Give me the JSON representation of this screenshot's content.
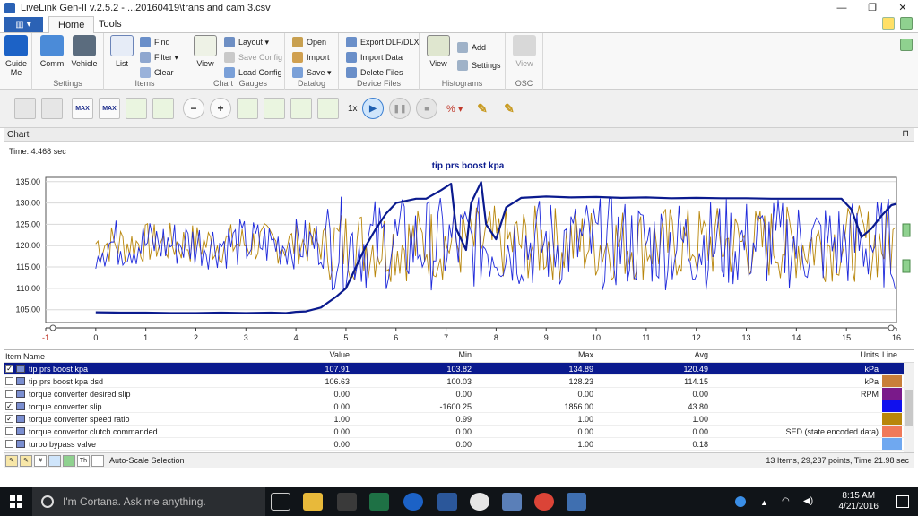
{
  "window": {
    "title": "LiveLink Gen-II  v.2.5.2 - ...20160419\\trans and cam 3.csv",
    "minimize": "—",
    "maximize": "❐",
    "close": "✕"
  },
  "tabs": {
    "home": "Home",
    "tools": "Tools"
  },
  "ribbon": {
    "guide": "Guide\nMe",
    "comm": "Comm",
    "vehicle": "Vehicle",
    "settings_group": "Settings",
    "list": "List",
    "find": "Find",
    "filter": "Filter ▾",
    "clear": "Clear",
    "items_group": "Items",
    "view": "View",
    "layout": "Layout ▾",
    "save_config": "Save Config",
    "load_config": "Load Config",
    "chart_group": "Chart",
    "gauges_group": "Gauges",
    "open": "Open",
    "import": "Import",
    "save": "Save ▾",
    "datalog_group": "Datalog",
    "export_dlf": "Export DLF/DLX",
    "import_data": "Import Data",
    "delete_files": "Delete Files",
    "device_files_group": "Device Files",
    "hist_view": "View",
    "add": "Add",
    "hist_settings": "Settings",
    "histograms_group": "Histograms",
    "osc_view": "View",
    "osc_group": "OSC"
  },
  "toolbar": {
    "max1": "MAX",
    "max2": "MAX",
    "speed": "1x",
    "percent": "% ▾"
  },
  "chart_panel": {
    "header": "Chart",
    "pin": "⊓",
    "time": "Time: 4.468 sec"
  },
  "chart_data": {
    "type": "line",
    "title": "tip prs boost kpa",
    "xlim": [
      -1,
      16
    ],
    "ylim": [
      102,
      136
    ],
    "x_ticks": [
      "-1",
      "0",
      "1",
      "2",
      "3",
      "4",
      "5",
      "6",
      "7",
      "8",
      "9",
      "10",
      "11",
      "12",
      "13",
      "14",
      "15",
      "16"
    ],
    "y_ticks": [
      "105.00",
      "110.00",
      "115.00",
      "120.00",
      "125.00",
      "130.00",
      "135.00"
    ],
    "series": [
      {
        "name": "tip prs boost kpa",
        "color": "#0a1a8e",
        "x": [
          0,
          0.5,
          1,
          1.5,
          2,
          2.5,
          3,
          3.5,
          3.8,
          4,
          4.2,
          4.5,
          4.8,
          5,
          5.2,
          5.4,
          5.6,
          5.8,
          6,
          6.2,
          6.4,
          6.6,
          6.9,
          7.1,
          7.2,
          7.4,
          7.5,
          7.7,
          7.8,
          8,
          8.2,
          8.5,
          9,
          9.5,
          10,
          10.5,
          11,
          11.5,
          12,
          12.5,
          13,
          13.5,
          14,
          14.5,
          14.9,
          15.1,
          15.3,
          15.5,
          15.7,
          15.9,
          16
        ],
        "y": [
          104.4,
          104.3,
          104.3,
          104.2,
          104.2,
          104.3,
          104.2,
          104.3,
          104.2,
          104.5,
          104.6,
          105.5,
          108,
          110,
          115,
          120,
          124,
          127.5,
          130,
          130.5,
          131,
          131,
          133,
          134.5,
          124,
          119,
          130,
          134.9,
          125,
          121.5,
          129,
          131.2,
          131.5,
          131.3,
          131.4,
          131.2,
          131.3,
          131.1,
          131.2,
          131.1,
          131.1,
          131.0,
          131.0,
          131.0,
          131.0,
          128.5,
          122,
          124,
          127,
          129.5,
          129.8
        ]
      },
      {
        "name": "torque converter slip",
        "color": "#1f2adb"
      },
      {
        "name": "torque converter speed ratio",
        "color": "#b8860b"
      }
    ]
  },
  "grid": {
    "headers": {
      "name": "Item Name",
      "value": "Value",
      "min": "Min",
      "max": "Max",
      "avg": "Avg",
      "units": "Units",
      "line": "Line"
    },
    "rows": [
      {
        "checked": true,
        "name": "tip prs boost kpa",
        "value": "107.91",
        "min": "103.82",
        "max": "134.89",
        "avg": "120.49",
        "units": "kPa",
        "color": "#0a1a8e"
      },
      {
        "checked": false,
        "name": "tip prs boost kpa dsd",
        "value": "106.63",
        "min": "100.03",
        "max": "128.23",
        "avg": "114.15",
        "units": "kPa",
        "color": "#c97f3a"
      },
      {
        "checked": false,
        "name": "torque converter desired slip",
        "value": "0.00",
        "min": "0.00",
        "max": "0.00",
        "avg": "0.00",
        "units": "RPM",
        "color": "#7a1a8a"
      },
      {
        "checked": true,
        "name": "torque converter slip",
        "value": "0.00",
        "min": "-1600.25",
        "max": "1856.00",
        "avg": "43.80",
        "units": "",
        "color": "#1010ee"
      },
      {
        "checked": true,
        "name": "torque converter speed ratio",
        "value": "1.00",
        "min": "0.99",
        "max": "1.00",
        "avg": "1.00",
        "units": "",
        "color": "#b8860b"
      },
      {
        "checked": false,
        "name": "torque convertor clutch commanded",
        "value": "0.00",
        "min": "0.00",
        "max": "0.00",
        "avg": "0.00",
        "units": "SED (state encoded data)",
        "color": "#f07a5a"
      },
      {
        "checked": false,
        "name": "turbo bypass valve",
        "value": "0.00",
        "min": "0.00",
        "max": "1.00",
        "avg": "0.18",
        "units": "",
        "color": "#6fa8f0"
      }
    ]
  },
  "statusbar": {
    "hash": "#",
    "th": "Th",
    "autoscale": "Auto-Scale Selection",
    "summary": "13 Items, 29,237 points, Time 21.98 sec"
  },
  "taskbar": {
    "cortana": "I'm Cortana. Ask me anything.",
    "time": "8:15 AM",
    "date": "4/21/2016"
  }
}
